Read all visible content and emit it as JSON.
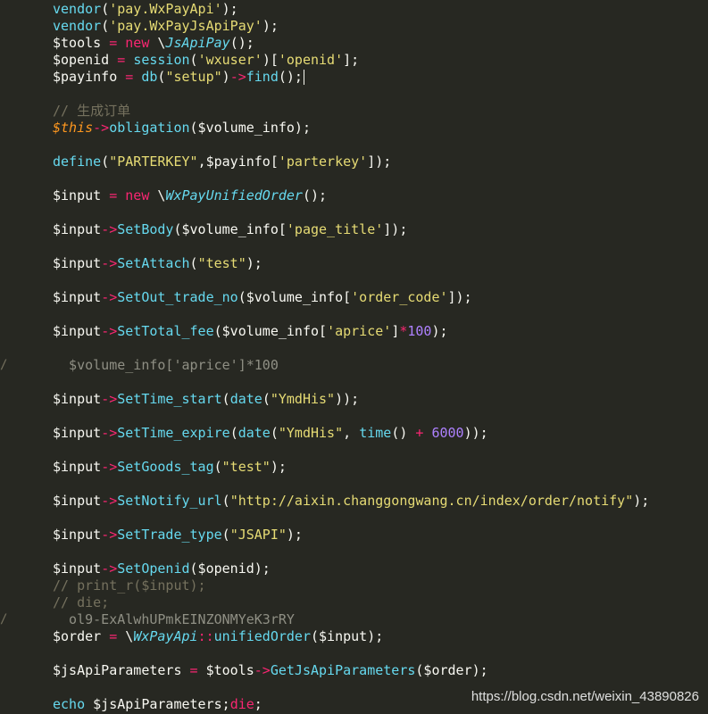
{
  "code_lines": [
    [
      {
        "t": "vendor",
        "c": "fn"
      },
      {
        "t": "(",
        "c": "var"
      },
      {
        "t": "'pay.WxPayApi'",
        "c": "str"
      },
      {
        "t": ");",
        "c": "var"
      }
    ],
    [
      {
        "t": "vendor",
        "c": "fn"
      },
      {
        "t": "(",
        "c": "var"
      },
      {
        "t": "'pay.WxPayJsApiPay'",
        "c": "str"
      },
      {
        "t": ");",
        "c": "var"
      }
    ],
    [
      {
        "t": "$tools ",
        "c": "var"
      },
      {
        "t": "=",
        "c": "kw"
      },
      {
        "t": " ",
        "c": "var"
      },
      {
        "t": "new",
        "c": "kw"
      },
      {
        "t": " \\",
        "c": "var"
      },
      {
        "t": "JsApiPay",
        "c": "cls"
      },
      {
        "t": "();",
        "c": "var"
      }
    ],
    [
      {
        "t": "$openid ",
        "c": "var"
      },
      {
        "t": "=",
        "c": "kw"
      },
      {
        "t": " ",
        "c": "var"
      },
      {
        "t": "session",
        "c": "fn"
      },
      {
        "t": "(",
        "c": "var"
      },
      {
        "t": "'wxuser'",
        "c": "str"
      },
      {
        "t": ")[",
        "c": "var"
      },
      {
        "t": "'openid'",
        "c": "str"
      },
      {
        "t": "];",
        "c": "var"
      }
    ],
    [
      {
        "t": "$payinfo ",
        "c": "var"
      },
      {
        "t": "=",
        "c": "kw"
      },
      {
        "t": " ",
        "c": "var"
      },
      {
        "t": "db",
        "c": "fn"
      },
      {
        "t": "(",
        "c": "var"
      },
      {
        "t": "\"setup\"",
        "c": "str"
      },
      {
        "t": ")",
        "c": "var"
      },
      {
        "t": "->",
        "c": "kw"
      },
      {
        "t": "find",
        "c": "fn"
      },
      {
        "t": "();",
        "c": "var"
      },
      {
        "t": "",
        "c": "caret"
      }
    ],
    [],
    [
      {
        "t": "// 生成订单",
        "c": "cm"
      }
    ],
    [
      {
        "t": "$this",
        "c": "this"
      },
      {
        "t": "->",
        "c": "kw"
      },
      {
        "t": "obligation",
        "c": "fn"
      },
      {
        "t": "($volume_info);",
        "c": "var"
      }
    ],
    [],
    [
      {
        "t": "define",
        "c": "fn"
      },
      {
        "t": "(",
        "c": "var"
      },
      {
        "t": "\"PARTERKEY\"",
        "c": "str"
      },
      {
        "t": ",$payinfo[",
        "c": "var"
      },
      {
        "t": "'parterkey'",
        "c": "str"
      },
      {
        "t": "]);",
        "c": "var"
      }
    ],
    [],
    [
      {
        "t": "$input ",
        "c": "var"
      },
      {
        "t": "=",
        "c": "kw"
      },
      {
        "t": " ",
        "c": "var"
      },
      {
        "t": "new",
        "c": "kw"
      },
      {
        "t": " \\",
        "c": "var"
      },
      {
        "t": "WxPayUnifiedOrder",
        "c": "cls"
      },
      {
        "t": "();",
        "c": "var"
      }
    ],
    [],
    [
      {
        "t": "$input",
        "c": "var"
      },
      {
        "t": "->",
        "c": "kw"
      },
      {
        "t": "SetBody",
        "c": "fn"
      },
      {
        "t": "($volume_info[",
        "c": "var"
      },
      {
        "t": "'page_title'",
        "c": "str"
      },
      {
        "t": "]);",
        "c": "var"
      }
    ],
    [],
    [
      {
        "t": "$input",
        "c": "var"
      },
      {
        "t": "->",
        "c": "kw"
      },
      {
        "t": "SetAttach",
        "c": "fn"
      },
      {
        "t": "(",
        "c": "var"
      },
      {
        "t": "\"test\"",
        "c": "str"
      },
      {
        "t": ");",
        "c": "var"
      }
    ],
    [],
    [
      {
        "t": "$input",
        "c": "var"
      },
      {
        "t": "->",
        "c": "kw"
      },
      {
        "t": "SetOut_trade_no",
        "c": "fn"
      },
      {
        "t": "($volume_info[",
        "c": "var"
      },
      {
        "t": "'order_code'",
        "c": "str"
      },
      {
        "t": "]);",
        "c": "var"
      }
    ],
    [],
    [
      {
        "t": "$input",
        "c": "var"
      },
      {
        "t": "->",
        "c": "kw"
      },
      {
        "t": "SetTotal_fee",
        "c": "fn"
      },
      {
        "t": "($volume_info[",
        "c": "var"
      },
      {
        "t": "'aprice'",
        "c": "str"
      },
      {
        "t": "]",
        "c": "var"
      },
      {
        "t": "*",
        "c": "kw"
      },
      {
        "t": "100",
        "c": "num"
      },
      {
        "t": ");",
        "c": "var"
      }
    ],
    [],
    [
      {
        "t": "  $volume_info['aprice']*100",
        "c": "ghost"
      }
    ],
    [],
    [
      {
        "t": "$input",
        "c": "var"
      },
      {
        "t": "->",
        "c": "kw"
      },
      {
        "t": "SetTime_start",
        "c": "fn"
      },
      {
        "t": "(",
        "c": "var"
      },
      {
        "t": "date",
        "c": "fn"
      },
      {
        "t": "(",
        "c": "var"
      },
      {
        "t": "\"YmdHis\"",
        "c": "str"
      },
      {
        "t": "));",
        "c": "var"
      }
    ],
    [],
    [
      {
        "t": "$input",
        "c": "var"
      },
      {
        "t": "->",
        "c": "kw"
      },
      {
        "t": "SetTime_expire",
        "c": "fn"
      },
      {
        "t": "(",
        "c": "var"
      },
      {
        "t": "date",
        "c": "fn"
      },
      {
        "t": "(",
        "c": "var"
      },
      {
        "t": "\"YmdHis\"",
        "c": "str"
      },
      {
        "t": ", ",
        "c": "var"
      },
      {
        "t": "time",
        "c": "fn"
      },
      {
        "t": "() ",
        "c": "var"
      },
      {
        "t": "+",
        "c": "kw"
      },
      {
        "t": " ",
        "c": "var"
      },
      {
        "t": "6000",
        "c": "num"
      },
      {
        "t": "));",
        "c": "var"
      }
    ],
    [],
    [
      {
        "t": "$input",
        "c": "var"
      },
      {
        "t": "->",
        "c": "kw"
      },
      {
        "t": "SetGoods_tag",
        "c": "fn"
      },
      {
        "t": "(",
        "c": "var"
      },
      {
        "t": "\"test\"",
        "c": "str"
      },
      {
        "t": ");",
        "c": "var"
      }
    ],
    [],
    [
      {
        "t": "$input",
        "c": "var"
      },
      {
        "t": "->",
        "c": "kw"
      },
      {
        "t": "SetNotify_url",
        "c": "fn"
      },
      {
        "t": "(",
        "c": "var"
      },
      {
        "t": "\"http://aixin.changgongwang.cn/index/order/notify\"",
        "c": "str"
      },
      {
        "t": ");",
        "c": "var"
      }
    ],
    [],
    [
      {
        "t": "$input",
        "c": "var"
      },
      {
        "t": "->",
        "c": "kw"
      },
      {
        "t": "SetTrade_type",
        "c": "fn"
      },
      {
        "t": "(",
        "c": "var"
      },
      {
        "t": "\"JSAPI\"",
        "c": "str"
      },
      {
        "t": ");",
        "c": "var"
      }
    ],
    [],
    [
      {
        "t": "$input",
        "c": "var"
      },
      {
        "t": "->",
        "c": "kw"
      },
      {
        "t": "SetOpenid",
        "c": "fn"
      },
      {
        "t": "($openid);",
        "c": "var"
      }
    ],
    [
      {
        "t": "// print_r($input);",
        "c": "cm"
      }
    ],
    [
      {
        "t": "// die;",
        "c": "cm"
      }
    ],
    [
      {
        "t": "  ol9-ExAlwhUPmkEINZONMYeK3rRY",
        "c": "ghost"
      }
    ],
    [
      {
        "t": "$order ",
        "c": "var"
      },
      {
        "t": "=",
        "c": "kw"
      },
      {
        "t": " \\",
        "c": "var"
      },
      {
        "t": "WxPayApi",
        "c": "cls"
      },
      {
        "t": "::",
        "c": "kw"
      },
      {
        "t": "unifiedOrder",
        "c": "fn"
      },
      {
        "t": "($input);",
        "c": "var"
      }
    ],
    [],
    [
      {
        "t": "$jsApiParameters ",
        "c": "var"
      },
      {
        "t": "=",
        "c": "kw"
      },
      {
        "t": " $tools",
        "c": "var"
      },
      {
        "t": "->",
        "c": "kw"
      },
      {
        "t": "GetJsApiParameters",
        "c": "fn"
      },
      {
        "t": "($order);",
        "c": "var"
      }
    ],
    [],
    [
      {
        "t": "echo",
        "c": "fn"
      },
      {
        "t": " $jsApiParameters;",
        "c": "var"
      },
      {
        "t": "die",
        "c": "kw"
      },
      {
        "t": ";",
        "c": "var"
      }
    ]
  ],
  "gutter_marks": [
    {
      "line": 21,
      "text": "/"
    },
    {
      "line": 36,
      "text": "/"
    }
  ],
  "watermark": "https://blog.csdn.net/weixin_43890826",
  "colors": {
    "background": "#272822",
    "text": "#f8f8f2",
    "string": "#e6db74",
    "function": "#66d9ef",
    "keyword": "#f92672",
    "number": "#ae81ff",
    "this": "#fd971f",
    "comment": "#75715e"
  }
}
